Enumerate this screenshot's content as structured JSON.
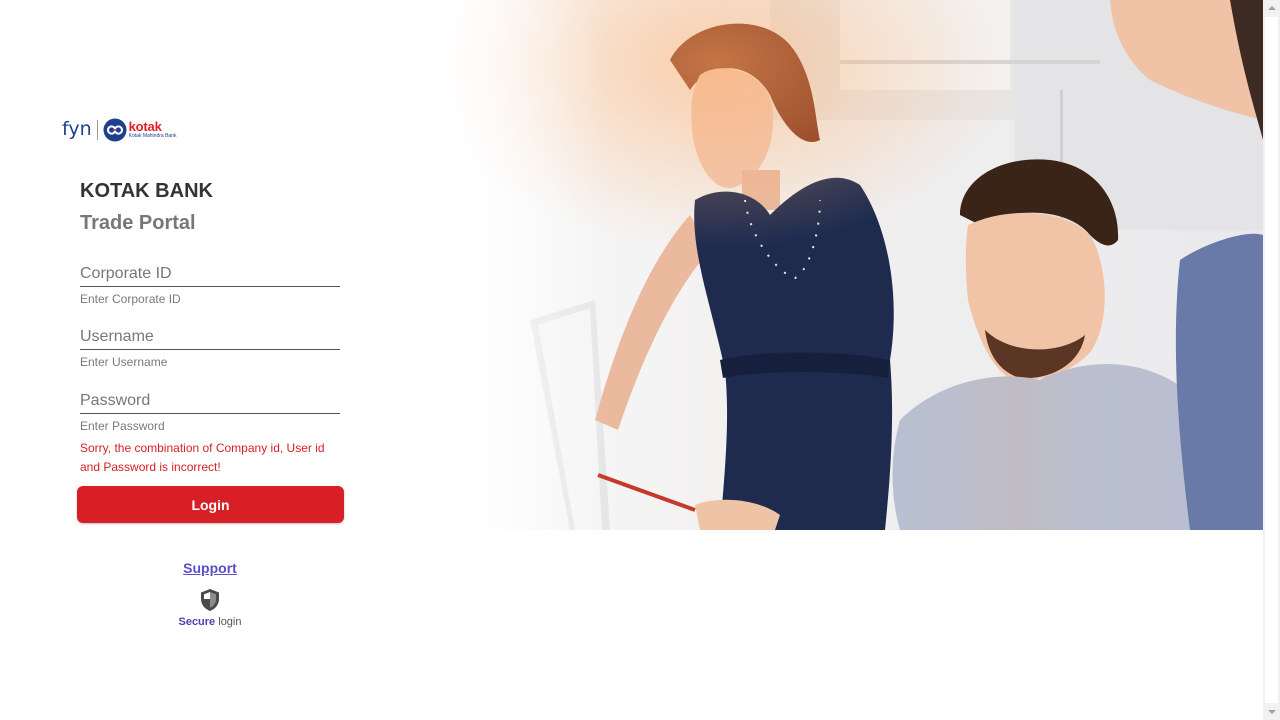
{
  "brand": {
    "fyn": "fyn",
    "kotak": "kotak",
    "kotak_sub": "Kotak Mahindra Bank",
    "accent": "#d81f26",
    "navy": "#1f3f8f"
  },
  "header": {
    "title": "KOTAK BANK",
    "subtitle": "Trade Portal"
  },
  "form": {
    "corporate_id": {
      "label": "Corporate ID",
      "hint": "Enter Corporate ID",
      "value": ""
    },
    "username": {
      "label": "Username",
      "hint": "Enter Username",
      "value": ""
    },
    "password": {
      "label": "Password",
      "hint": "Enter Password",
      "value": ""
    },
    "error": "Sorry, the combination of Company id, User id and Password is incorrect!",
    "login_label": "Login"
  },
  "footer": {
    "support_label": "Support",
    "secure_strong": "Secure",
    "secure_rest": "login",
    "secure_icon": "shield-icon"
  },
  "hero": {
    "image": "people-at-computer-photo"
  }
}
